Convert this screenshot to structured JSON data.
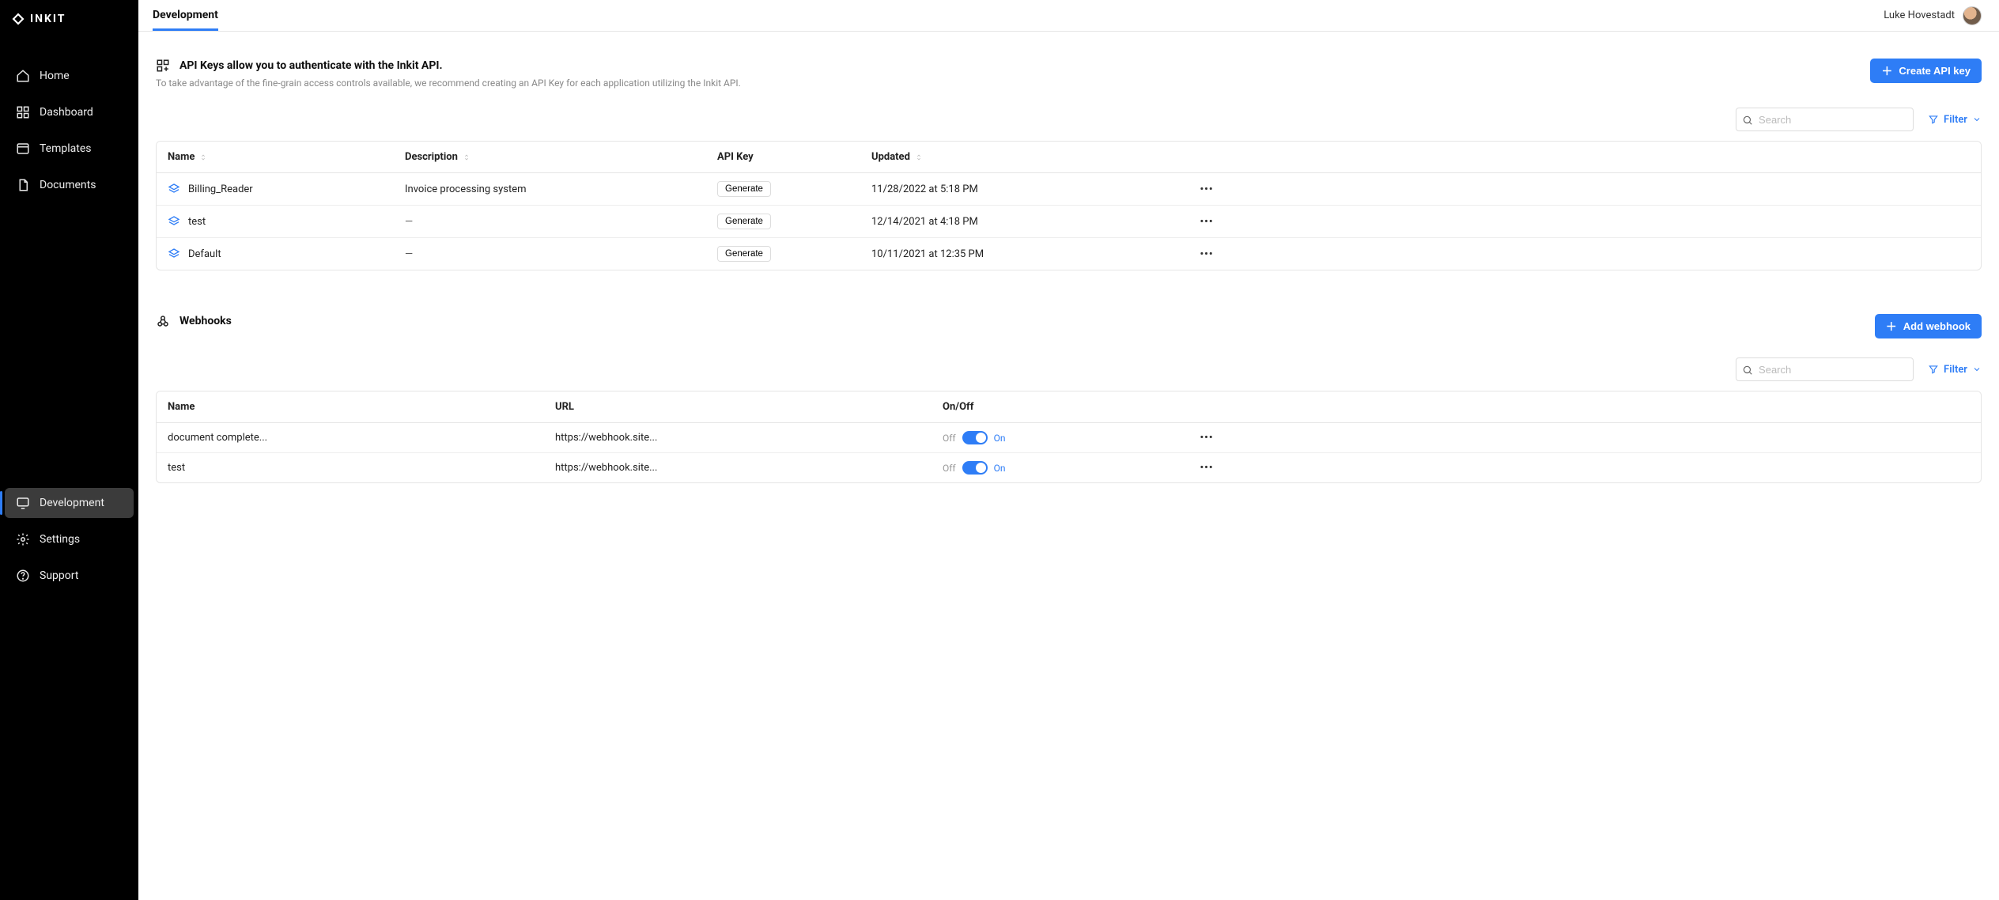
{
  "brand": "INKIT",
  "user": {
    "name": "Luke Hovestadt"
  },
  "tabs": [
    {
      "label": "Development",
      "active": true
    }
  ],
  "sidebar": {
    "items": [
      {
        "label": "Home"
      },
      {
        "label": "Dashboard"
      },
      {
        "label": "Templates"
      },
      {
        "label": "Documents"
      }
    ],
    "bottom": [
      {
        "label": "Development",
        "active": true
      },
      {
        "label": "Settings"
      },
      {
        "label": "Support"
      }
    ]
  },
  "apikeys": {
    "title": "API Keys allow you to authenticate with the Inkit API.",
    "subtitle": "To take advantage of the fine-grain access controls available, we recommend creating an API Key for each application utilizing the Inkit API.",
    "create_label": "Create API key",
    "search_placeholder": "Search",
    "filter_label": "Filter",
    "columns": {
      "name": "Name",
      "description": "Description",
      "apikey": "API Key",
      "updated": "Updated"
    },
    "generate_label": "Generate",
    "rows": [
      {
        "name": "Billing_Reader",
        "description": "Invoice processing system",
        "updated": "11/28/2022 at 5:18 PM"
      },
      {
        "name": "test",
        "description": "—",
        "updated": "12/14/2021 at 4:18 PM"
      },
      {
        "name": "Default",
        "description": "—",
        "updated": "10/11/2021 at 12:35 PM"
      }
    ]
  },
  "webhooks": {
    "title": "Webhooks",
    "add_label": "Add webhook",
    "search_placeholder": "Search",
    "filter_label": "Filter",
    "columns": {
      "name": "Name",
      "url": "URL",
      "onoff": "On/Off"
    },
    "off_label": "Off",
    "on_label": "On",
    "rows": [
      {
        "name": "document complete...",
        "url": "https://webhook.site...",
        "on": true
      },
      {
        "name": "test",
        "url": "https://webhook.site...",
        "on": true
      }
    ]
  }
}
